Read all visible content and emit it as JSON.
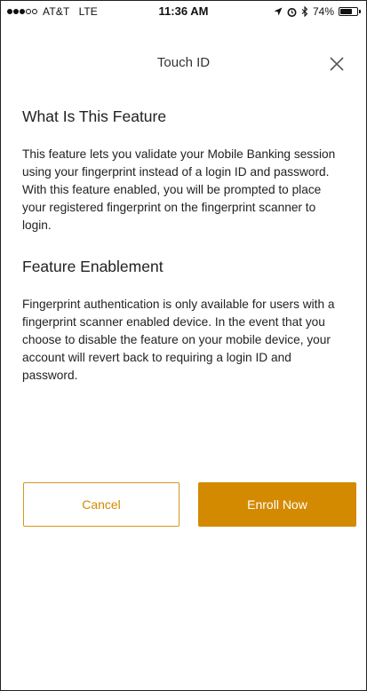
{
  "status_bar": {
    "carrier": "AT&T",
    "network": "LTE",
    "time": "11:36 AM",
    "battery": "74%",
    "signal_bars_filled": 3,
    "signal_bars_total": 5,
    "battery_level": 0.74,
    "icons": [
      "location-arrow-icon",
      "alarm-icon",
      "bluetooth-icon"
    ]
  },
  "header": {
    "title": "Touch ID",
    "close_icon": "close-icon"
  },
  "sections": [
    {
      "title": "What Is This Feature",
      "body": "This feature lets you validate your Mobile Banking session using your fingerprint instead of a login ID and password. With this feature enabled, you will be prompted to place your registered fingerprint on the fingerprint scanner to login."
    },
    {
      "title": "Feature Enablement",
      "body": "Fingerprint authentication is only available for users with a fingerprint scanner enabled device. In the event that you choose to disable the feature on your mobile device, your account will revert back to requiring a login ID and password."
    }
  ],
  "actions": {
    "cancel_label": "Cancel",
    "enroll_label": "Enroll Now"
  },
  "colors": {
    "accent": "#D38A00",
    "text": "#222222"
  }
}
